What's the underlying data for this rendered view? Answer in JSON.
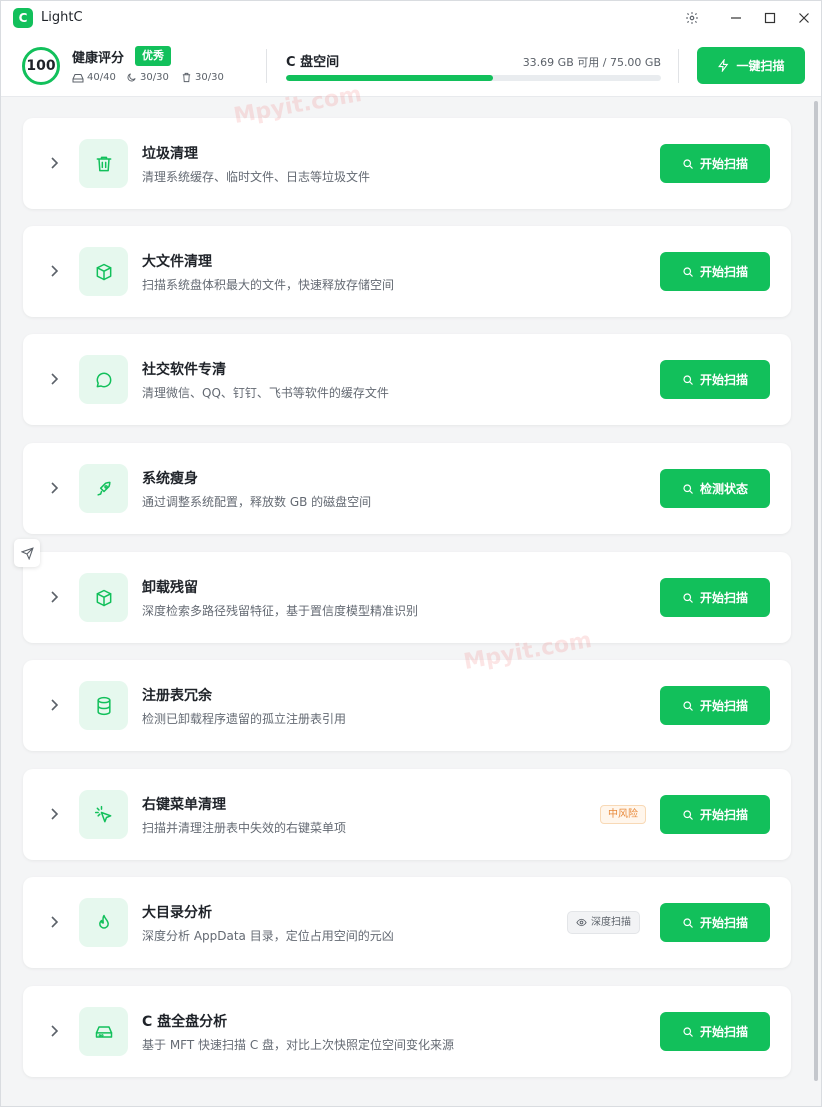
{
  "window": {
    "title": "LightC",
    "logo_glyph": "C"
  },
  "header": {
    "score": "100",
    "health_label": "健康评分",
    "health_badge": "优秀",
    "stats": [
      {
        "icon": "disk-icon",
        "value": "40/40"
      },
      {
        "icon": "moon-icon",
        "value": "30/30"
      },
      {
        "icon": "trash-icon",
        "value": "30/30"
      }
    ],
    "disk_title": "C 盘空间",
    "disk_info": "33.69 GB 可用 / 75.00 GB",
    "disk_used_fraction": 0.551,
    "oneclick_label": "一键扫描"
  },
  "watermark": "Mpyit.com",
  "items": [
    {
      "icon": "trash-icon",
      "title": "垃圾清理",
      "desc": "清理系统缓存、临时文件、日志等垃圾文件",
      "button": "开始扫描"
    },
    {
      "icon": "file-box-icon",
      "title": "大文件清理",
      "desc": "扫描系统盘体积最大的文件，快速释放存储空间",
      "button": "开始扫描"
    },
    {
      "icon": "chat-icon",
      "title": "社交软件专清",
      "desc": "清理微信、QQ、钉钉、飞书等软件的缓存文件",
      "button": "开始扫描"
    },
    {
      "icon": "rocket-icon",
      "title": "系统瘦身",
      "desc": "通过调整系统配置，释放数 GB 的磁盘空间",
      "button": "检测状态"
    },
    {
      "icon": "package-icon",
      "title": "卸载残留",
      "desc": "深度检索多路径残留特征，基于置信度模型精准识别",
      "button": "开始扫描"
    },
    {
      "icon": "database-icon",
      "title": "注册表冗余",
      "desc": "检测已卸载程序遗留的孤立注册表引用",
      "button": "开始扫描"
    },
    {
      "icon": "cursor-click-icon",
      "title": "右键菜单清理",
      "desc": "扫描并清理注册表中失效的右键菜单项",
      "button": "开始扫描",
      "tag": "中风险"
    },
    {
      "icon": "flame-icon",
      "title": "大目录分析",
      "desc": "深度分析 AppData 目录，定位占用空间的元凶",
      "button": "开始扫描",
      "tag_deep": "深度扫描"
    },
    {
      "icon": "hard-drive-icon",
      "title": "C 盘全盘分析",
      "desc": "基于 MFT 快速扫描 C 盘，对比上次快照定位空间变化来源",
      "button": "开始扫描"
    }
  ],
  "colors": {
    "accent": "#12c05b",
    "accent_light": "#e6f8ee",
    "risk": "#e8893a"
  }
}
